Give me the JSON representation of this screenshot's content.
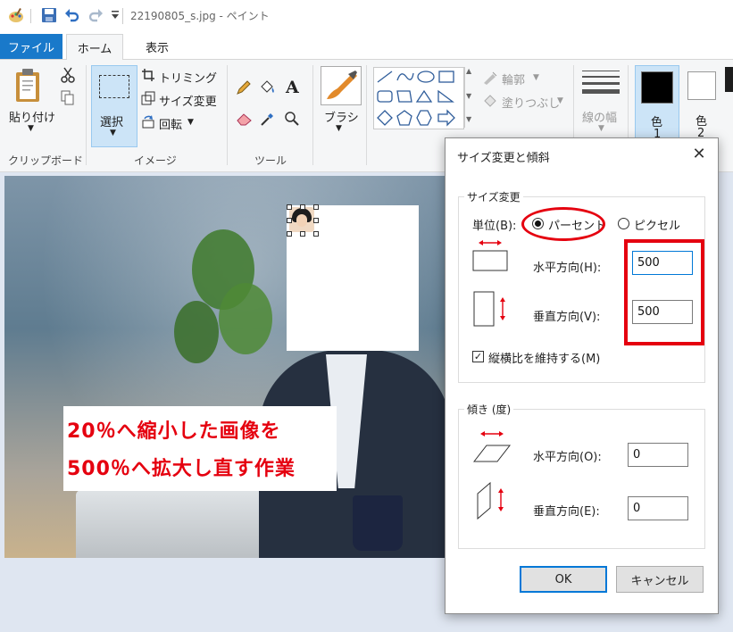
{
  "window": {
    "title": "22190805_s.jpg - ペイント"
  },
  "tabs": {
    "file": "ファイル",
    "home": "ホーム",
    "view": "表示"
  },
  "ribbon": {
    "clipboard": {
      "paste": "貼り付け",
      "group": "クリップボード"
    },
    "image": {
      "select": "選択",
      "crop": "トリミング",
      "resize": "サイズ変更",
      "rotate": "回転",
      "group": "イメージ"
    },
    "tools": {
      "group": "ツール"
    },
    "brushes": {
      "label": "ブラシ"
    },
    "shapes": {
      "outline": "輪郭",
      "fill": "塗りつぶし"
    },
    "size": {
      "label": "線の幅"
    },
    "colors": {
      "color1_a": "色",
      "color1_b": "1",
      "color2_a": "色",
      "color2_b": "2",
      "color1_value": "#000000",
      "color2_value": "#ffffff"
    }
  },
  "canvas": {
    "caption_line1": "20％へ縮小した画像を",
    "caption_line2": "500％へ拡大し直す作業"
  },
  "dialog": {
    "title": "サイズ変更と傾斜",
    "resize": {
      "legend": "サイズ変更",
      "unit_label": "単位(B):",
      "percent_label": "パーセント",
      "pixel_label": "ピクセル",
      "selected_unit": "パーセント",
      "horizontal_label": "水平方向(H):",
      "horizontal_value": "500",
      "vertical_label": "垂直方向(V):",
      "vertical_value": "500",
      "keep_ratio_label": "縦横比を維持する(M)",
      "keep_ratio_checked": true
    },
    "skew": {
      "legend": "傾き (度)",
      "horizontal_label": "水平方向(O):",
      "horizontal_value": "0",
      "vertical_label": "垂直方向(E):",
      "vertical_value": "0"
    },
    "ok": "OK",
    "cancel": "キャンセル"
  },
  "colors": {
    "accent": "#1979ca",
    "highlight_red": "#e5000f"
  }
}
